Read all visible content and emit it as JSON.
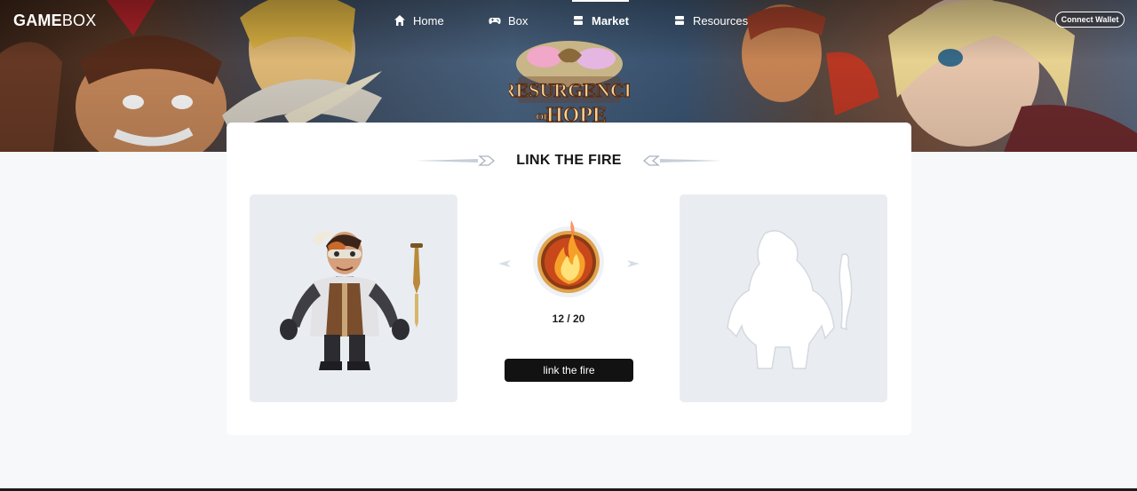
{
  "brand": {
    "logo_bold": "GAME",
    "logo_light": "BOX"
  },
  "nav": {
    "items": [
      {
        "label": "Home",
        "icon": "home-icon",
        "active": false
      },
      {
        "label": "Box",
        "icon": "gamepad-icon",
        "active": false
      },
      {
        "label": "Market",
        "icon": "store-icon",
        "active": true
      },
      {
        "label": "Resources",
        "icon": "stack-icon",
        "active": false
      }
    ],
    "connect_label": "Connect Wallet"
  },
  "banner": {
    "game_logo_line1": "RESURGENCE",
    "game_logo_line2_small": "OF",
    "game_logo_line2": "HOPE"
  },
  "card": {
    "title": "LINK THE FIRE",
    "counter": "12 / 20",
    "button_label": "link the fire"
  },
  "colors": {
    "accent": "#121212",
    "slot_bg": "#e9edf2",
    "page_bg": "#f6f8fa"
  }
}
